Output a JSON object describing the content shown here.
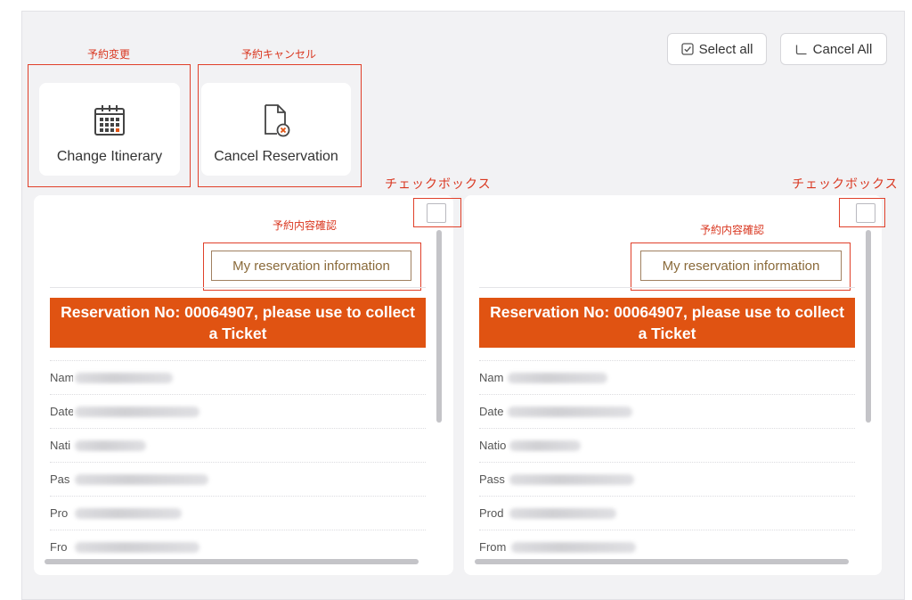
{
  "annotations": {
    "change_itinerary": "予約変更",
    "cancel_reservation": "予約キャンセル",
    "checkbox_left": "チェックボックス",
    "checkbox_right": "チェックボックス",
    "confirm_left": "予約内容確認",
    "confirm_right": "予約内容確認",
    "accent_color": "#d9361f"
  },
  "toolbar": {
    "select_all_label": "Select all",
    "cancel_all_label": "Cancel All"
  },
  "actions": {
    "change_itinerary_label": "Change Itinerary",
    "cancel_reservation_label": "Cancel Reservation"
  },
  "reservations": [
    {
      "info_button": "My reservation information",
      "banner": "Reservation No: 00064907, please use to collect a Ticket",
      "rows": [
        {
          "label": "Nam"
        },
        {
          "label": "Date"
        },
        {
          "label": "Nati"
        },
        {
          "label": "Pas"
        },
        {
          "label": "Pro"
        },
        {
          "label": "Fro"
        }
      ]
    },
    {
      "info_button": "My reservation information",
      "banner": "Reservation No: 00064907, please use to collect a Ticket",
      "rows": [
        {
          "label": "Nam"
        },
        {
          "label": "Date"
        },
        {
          "label": "Natio"
        },
        {
          "label": "Pass"
        },
        {
          "label": "Prod"
        },
        {
          "label": "From"
        }
      ]
    }
  ],
  "colors": {
    "banner": "#e05312",
    "info_button_text": "#8a6a3a",
    "background": "#f2f2f4"
  }
}
